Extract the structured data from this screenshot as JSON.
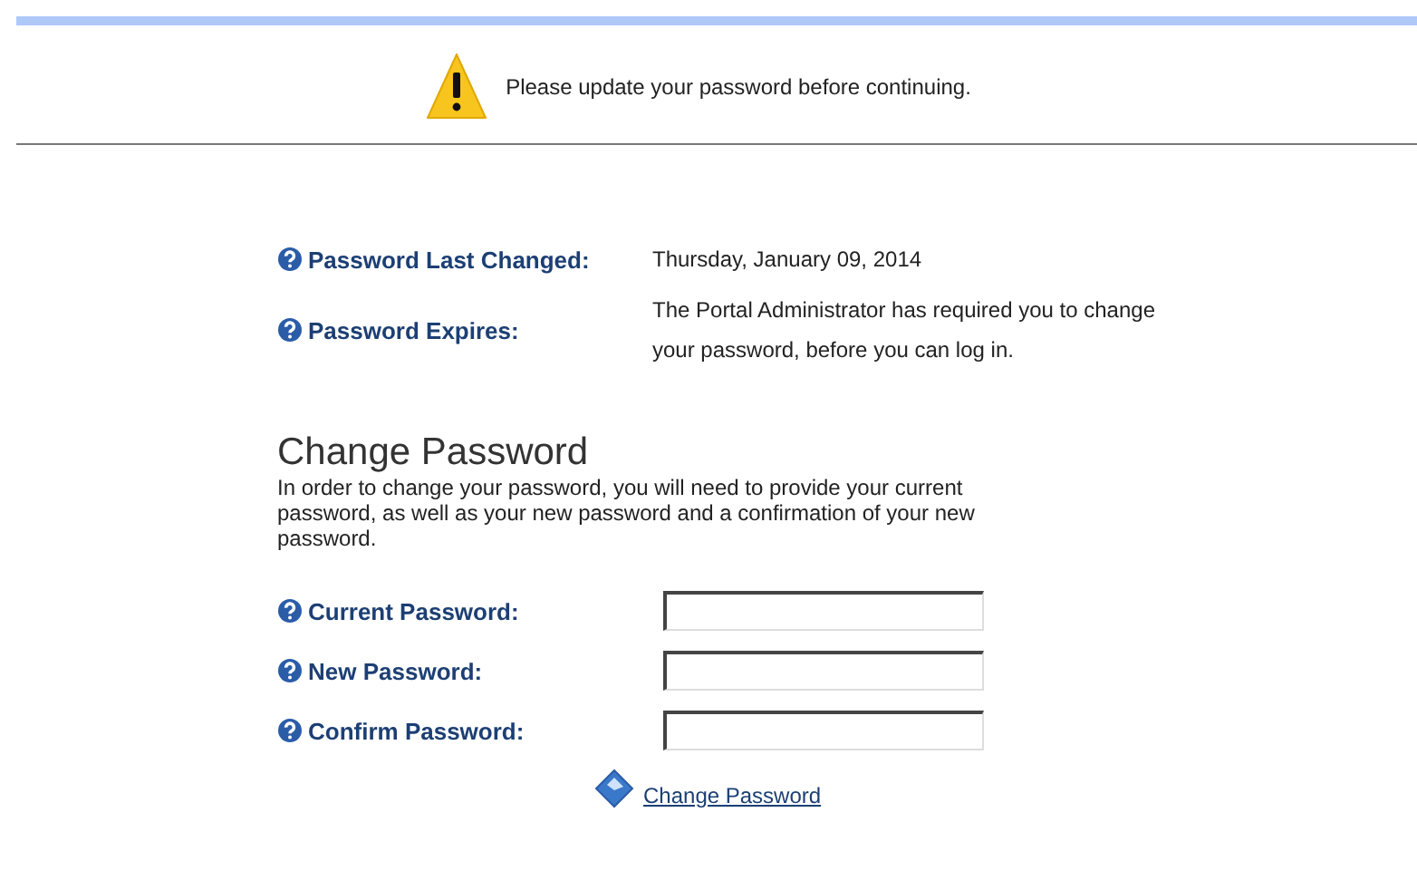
{
  "notice": {
    "message": "Please update your password before continuing."
  },
  "info": [
    {
      "label": "Password Last Changed:",
      "value": "Thursday, January 09, 2014"
    },
    {
      "label": "Password Expires:",
      "value": "The Portal Administrator has required you to change your password, before you can log in."
    }
  ],
  "change_password": {
    "title": "Change Password",
    "description": "In order to change your password, you will need to provide your current password, as well as your new password and a confirmation of your new password.",
    "fields": [
      {
        "label": "Current Password:"
      },
      {
        "label": "New Password:"
      },
      {
        "label": "Confirm Password:"
      }
    ],
    "submit_link": "Change Password"
  }
}
